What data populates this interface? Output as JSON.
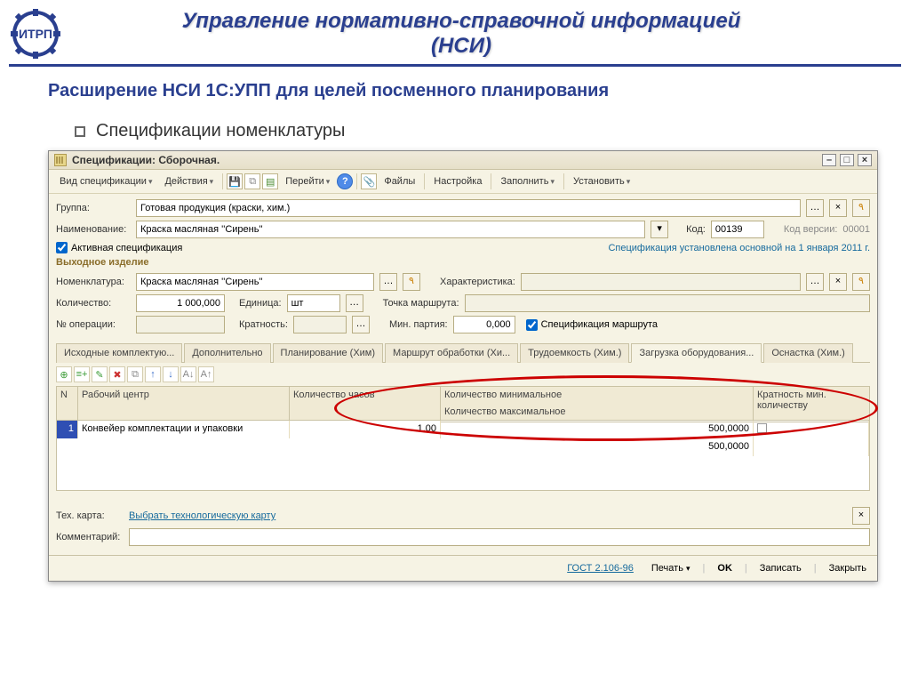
{
  "banner": {
    "title_l1": "Управление нормативно-справочной информацией",
    "title_l2": "(НСИ)"
  },
  "subtitle": "Расширение НСИ 1С:УПП для целей посменного планирования",
  "bullet": "Спецификации номенклатуры",
  "window": {
    "title": "Спецификации: Сборочная.",
    "menus": {
      "spec_type": "Вид спецификации",
      "actions": "Действия",
      "goto": "Перейти",
      "files": "Файлы",
      "settings": "Настройка",
      "fill": "Заполнить",
      "set": "Установить"
    }
  },
  "form": {
    "group_label": "Группа:",
    "group_value": "Готовая продукция (краски, хим.)",
    "name_label": "Наименование:",
    "name_value": "Краска масляная ''Сирень''",
    "code_label": "Код:",
    "code_value": "00139",
    "ver_label": "Код версии:",
    "ver_value": "00001",
    "active_label": "Активная спецификация",
    "default_note": "Спецификация установлена основной на 1 января 2011 г.",
    "section_output": "Выходное изделие",
    "nomen_label": "Номенклатура:",
    "nomen_value": "Краска масляная ''Сирень''",
    "char_label": "Характеристика:",
    "qty_label": "Количество:",
    "qty_value": "1 000,000",
    "unit_label": "Единица:",
    "unit_value": "шт",
    "route_pt_label": "Точка маршрута:",
    "op_no_label": "№ операции:",
    "mult_label": "Кратность:",
    "min_batch_label": "Мин. партия:",
    "min_batch_value": "0,000",
    "route_spec_label": "Спецификация маршрута"
  },
  "tabs": {
    "t0": "Исходные комплектую...",
    "t1": "Дополнительно",
    "t2": "Планирование (Хим)",
    "t3": "Маршрут обработки (Хи...",
    "t4": "Трудоемкость (Хим.)",
    "t5": "Загрузка оборудования...",
    "t6": "Оснастка (Хим.)"
  },
  "grid": {
    "h_n": "N",
    "h_center": "Рабочий центр",
    "h_hours": "Количество часов",
    "h_min": "Количество минимальное",
    "h_max": "Количество максимальное",
    "h_mult": "Кратность мин. количеству",
    "r1_n": "1",
    "r1_center": "Конвейер комплектации и упаковки",
    "r1_hours": "1,00",
    "r1_min": "500,0000",
    "r1_max": "500,0000"
  },
  "bottom": {
    "tech_label": "Тех. карта:",
    "tech_link": "Выбрать технологическую карту",
    "comment_label": "Комментарий:"
  },
  "footer": {
    "gost": "ГОСТ 2.106-96",
    "print": "Печать",
    "ok": "OK",
    "save": "Записать",
    "close": "Закрыть"
  }
}
